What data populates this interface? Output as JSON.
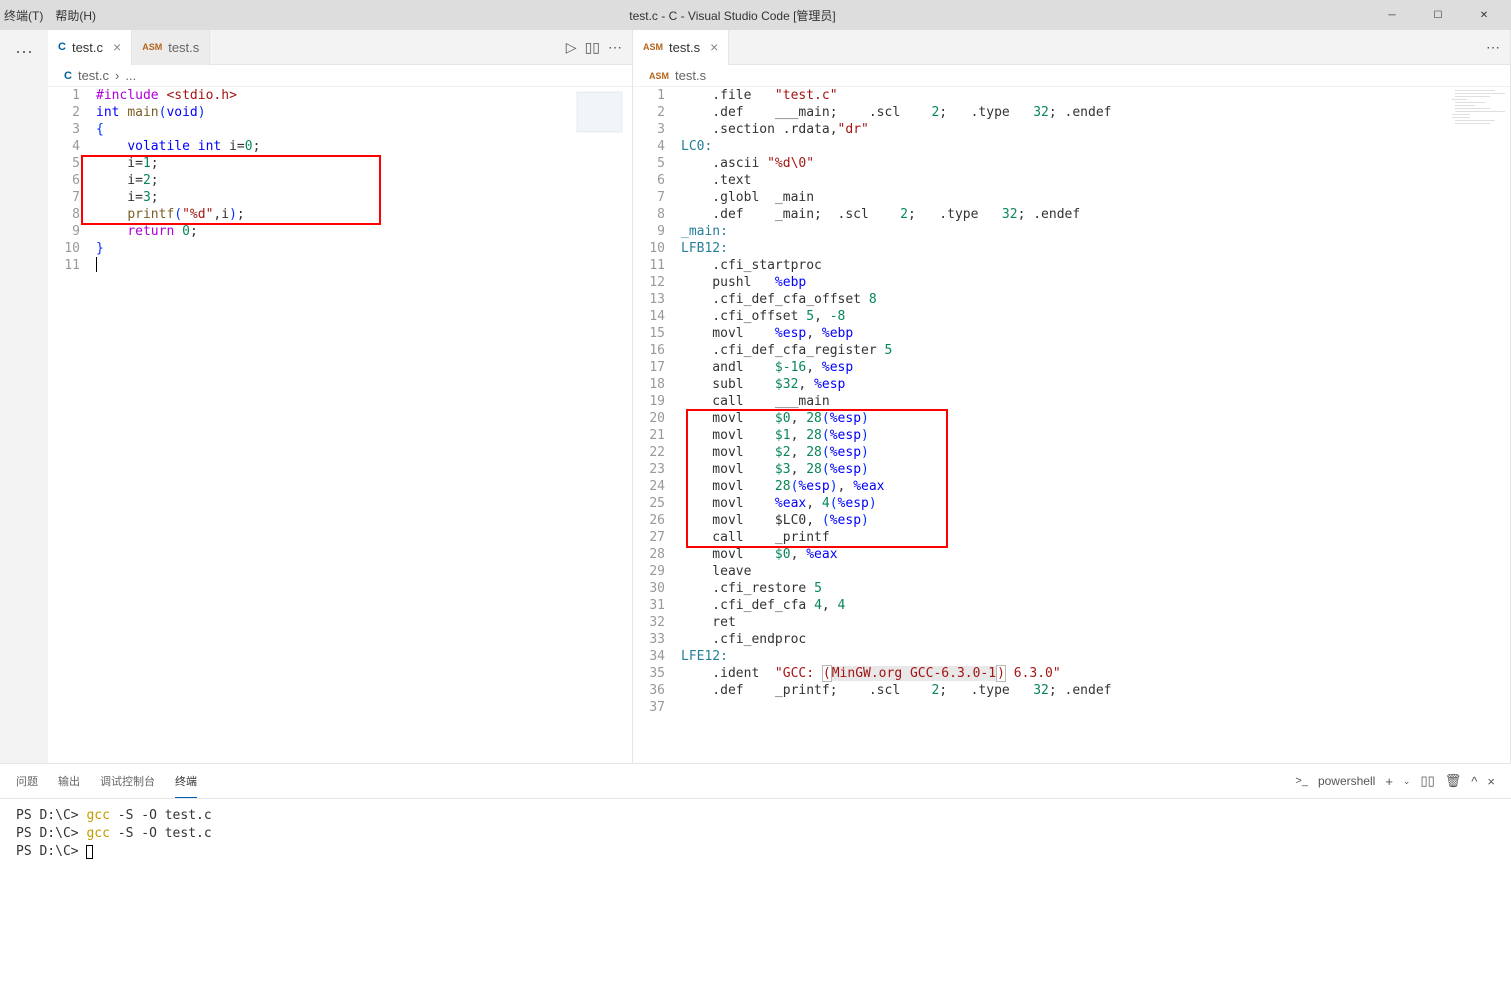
{
  "window": {
    "title": "test.c - C - Visual Studio Code [管理员]",
    "menu_terminal": "终端(T)",
    "menu_help": "帮助(H)"
  },
  "tabs": {
    "left": [
      {
        "icon": "C",
        "label": "test.c",
        "active": true,
        "close": "×"
      },
      {
        "icon": "ASM",
        "label": "test.s",
        "active": false,
        "close": ""
      }
    ],
    "right": [
      {
        "icon": "ASM",
        "label": "test.s",
        "active": true,
        "close": "×"
      }
    ]
  },
  "breadcrumb": {
    "left": {
      "icon": "C",
      "file": "test.c",
      "sep": "›",
      "more": "..."
    },
    "right": {
      "icon": "ASM",
      "file": "test.s"
    }
  },
  "editor_left": {
    "lines": [
      {
        "n": "1",
        "tokens": [
          {
            "t": "#include ",
            "c": "kw-purple"
          },
          {
            "t": "<stdio.h>",
            "c": "kw-str"
          }
        ]
      },
      {
        "n": "2",
        "tokens": [
          {
            "t": "int",
            "c": "kw-blue"
          },
          {
            "t": " ",
            "c": ""
          },
          {
            "t": "main",
            "c": "kw-brown"
          },
          {
            "t": "(",
            "c": "kw-paren"
          },
          {
            "t": "void",
            "c": "kw-blue"
          },
          {
            "t": ")",
            "c": "kw-paren"
          }
        ]
      },
      {
        "n": "3",
        "tokens": [
          {
            "t": "{",
            "c": "kw-paren"
          }
        ]
      },
      {
        "n": "4",
        "tokens": [
          {
            "t": "    ",
            "c": ""
          },
          {
            "t": "volatile",
            "c": "kw-blue"
          },
          {
            "t": " ",
            "c": ""
          },
          {
            "t": "int",
            "c": "kw-blue"
          },
          {
            "t": " i=",
            "c": ""
          },
          {
            "t": "0",
            "c": "kw-green"
          },
          {
            "t": ";",
            "c": ""
          }
        ]
      },
      {
        "n": "5",
        "tokens": [
          {
            "t": "    i=",
            "c": ""
          },
          {
            "t": "1",
            "c": "kw-green"
          },
          {
            "t": ";",
            "c": ""
          }
        ]
      },
      {
        "n": "6",
        "tokens": [
          {
            "t": "    i=",
            "c": ""
          },
          {
            "t": "2",
            "c": "kw-green"
          },
          {
            "t": ";",
            "c": ""
          }
        ]
      },
      {
        "n": "7",
        "tokens": [
          {
            "t": "    i=",
            "c": ""
          },
          {
            "t": "3",
            "c": "kw-green"
          },
          {
            "t": ";",
            "c": ""
          }
        ]
      },
      {
        "n": "8",
        "tokens": [
          {
            "t": "    ",
            "c": ""
          },
          {
            "t": "printf",
            "c": "kw-brown"
          },
          {
            "t": "(",
            "c": "kw-paren"
          },
          {
            "t": "\"%d\"",
            "c": "kw-str"
          },
          {
            "t": ",i",
            "c": ""
          },
          {
            "t": ")",
            "c": "kw-paren"
          },
          {
            "t": ";",
            "c": ""
          }
        ]
      },
      {
        "n": "9",
        "tokens": [
          {
            "t": "    ",
            "c": ""
          },
          {
            "t": "return",
            "c": "kw-purple"
          },
          {
            "t": " ",
            "c": ""
          },
          {
            "t": "0",
            "c": "kw-green"
          },
          {
            "t": ";",
            "c": ""
          }
        ]
      },
      {
        "n": "10",
        "tokens": [
          {
            "t": "}",
            "c": "kw-paren"
          }
        ]
      },
      {
        "n": "11",
        "tokens": []
      }
    ]
  },
  "editor_right": {
    "lines": [
      {
        "n": "1",
        "tokens": [
          {
            "t": "    .file   ",
            "c": ""
          },
          {
            "t": "\"test.c\"",
            "c": "kw-str"
          }
        ]
      },
      {
        "n": "2",
        "tokens": [
          {
            "t": "    .def    ___main;    .scl    ",
            "c": ""
          },
          {
            "t": "2",
            "c": "kw-green"
          },
          {
            "t": ";   .type   ",
            "c": ""
          },
          {
            "t": "32",
            "c": "kw-green"
          },
          {
            "t": "; .endef",
            "c": ""
          }
        ]
      },
      {
        "n": "3",
        "tokens": [
          {
            "t": "    .section .rdata,",
            "c": ""
          },
          {
            "t": "\"dr\"",
            "c": "kw-str"
          }
        ]
      },
      {
        "n": "4",
        "tokens": [
          {
            "t": "LC0:",
            "c": "kw-teal"
          }
        ]
      },
      {
        "n": "5",
        "tokens": [
          {
            "t": "    .ascii ",
            "c": ""
          },
          {
            "t": "\"%d\\0\"",
            "c": "kw-str"
          }
        ]
      },
      {
        "n": "6",
        "tokens": [
          {
            "t": "    .text",
            "c": ""
          }
        ]
      },
      {
        "n": "7",
        "tokens": [
          {
            "t": "    .globl  _main",
            "c": ""
          }
        ]
      },
      {
        "n": "8",
        "tokens": [
          {
            "t": "    .def    _main;  .scl    ",
            "c": ""
          },
          {
            "t": "2",
            "c": "kw-green"
          },
          {
            "t": ";   .type   ",
            "c": ""
          },
          {
            "t": "32",
            "c": "kw-green"
          },
          {
            "t": "; .endef",
            "c": ""
          }
        ]
      },
      {
        "n": "9",
        "tokens": [
          {
            "t": "_main:",
            "c": "kw-teal"
          }
        ]
      },
      {
        "n": "10",
        "tokens": [
          {
            "t": "LFB12:",
            "c": "kw-teal"
          }
        ]
      },
      {
        "n": "11",
        "tokens": [
          {
            "t": "    .cfi_startproc",
            "c": ""
          }
        ]
      },
      {
        "n": "12",
        "tokens": [
          {
            "t": "    pushl   ",
            "c": ""
          },
          {
            "t": "%ebp",
            "c": "kw-blue"
          }
        ]
      },
      {
        "n": "13",
        "tokens": [
          {
            "t": "    .cfi_def_cfa_offset ",
            "c": ""
          },
          {
            "t": "8",
            "c": "kw-green"
          }
        ]
      },
      {
        "n": "14",
        "tokens": [
          {
            "t": "    .cfi_offset ",
            "c": ""
          },
          {
            "t": "5",
            "c": "kw-green"
          },
          {
            "t": ", ",
            "c": ""
          },
          {
            "t": "-8",
            "c": "kw-green"
          }
        ]
      },
      {
        "n": "15",
        "tokens": [
          {
            "t": "    movl    ",
            "c": ""
          },
          {
            "t": "%esp",
            "c": "kw-blue"
          },
          {
            "t": ", ",
            "c": ""
          },
          {
            "t": "%ebp",
            "c": "kw-blue"
          }
        ]
      },
      {
        "n": "16",
        "tokens": [
          {
            "t": "    .cfi_def_cfa_register ",
            "c": ""
          },
          {
            "t": "5",
            "c": "kw-green"
          }
        ]
      },
      {
        "n": "17",
        "tokens": [
          {
            "t": "    andl    ",
            "c": ""
          },
          {
            "t": "$-16",
            "c": "kw-green"
          },
          {
            "t": ", ",
            "c": ""
          },
          {
            "t": "%esp",
            "c": "kw-blue"
          }
        ]
      },
      {
        "n": "18",
        "tokens": [
          {
            "t": "    subl    ",
            "c": ""
          },
          {
            "t": "$32",
            "c": "kw-green"
          },
          {
            "t": ", ",
            "c": ""
          },
          {
            "t": "%esp",
            "c": "kw-blue"
          }
        ]
      },
      {
        "n": "19",
        "tokens": [
          {
            "t": "    call    ___main",
            "c": ""
          }
        ]
      },
      {
        "n": "20",
        "tokens": [
          {
            "t": "    movl    ",
            "c": ""
          },
          {
            "t": "$0",
            "c": "kw-green"
          },
          {
            "t": ", ",
            "c": ""
          },
          {
            "t": "28",
            "c": "kw-green"
          },
          {
            "t": "(",
            "c": "kw-paren"
          },
          {
            "t": "%esp",
            "c": "kw-blue"
          },
          {
            "t": ")",
            "c": "kw-paren"
          }
        ]
      },
      {
        "n": "21",
        "tokens": [
          {
            "t": "    movl    ",
            "c": ""
          },
          {
            "t": "$1",
            "c": "kw-green"
          },
          {
            "t": ", ",
            "c": ""
          },
          {
            "t": "28",
            "c": "kw-green"
          },
          {
            "t": "(",
            "c": "kw-paren"
          },
          {
            "t": "%esp",
            "c": "kw-blue"
          },
          {
            "t": ")",
            "c": "kw-paren"
          }
        ]
      },
      {
        "n": "22",
        "tokens": [
          {
            "t": "    movl    ",
            "c": ""
          },
          {
            "t": "$2",
            "c": "kw-green"
          },
          {
            "t": ", ",
            "c": ""
          },
          {
            "t": "28",
            "c": "kw-green"
          },
          {
            "t": "(",
            "c": "kw-paren"
          },
          {
            "t": "%esp",
            "c": "kw-blue"
          },
          {
            "t": ")",
            "c": "kw-paren"
          }
        ]
      },
      {
        "n": "23",
        "tokens": [
          {
            "t": "    movl    ",
            "c": ""
          },
          {
            "t": "$3",
            "c": "kw-green"
          },
          {
            "t": ", ",
            "c": ""
          },
          {
            "t": "28",
            "c": "kw-green"
          },
          {
            "t": "(",
            "c": "kw-paren"
          },
          {
            "t": "%esp",
            "c": "kw-blue"
          },
          {
            "t": ")",
            "c": "kw-paren"
          }
        ]
      },
      {
        "n": "24",
        "tokens": [
          {
            "t": "    movl    ",
            "c": ""
          },
          {
            "t": "28",
            "c": "kw-green"
          },
          {
            "t": "(",
            "c": "kw-paren"
          },
          {
            "t": "%esp",
            "c": "kw-blue"
          },
          {
            "t": ")",
            "c": "kw-paren"
          },
          {
            "t": ", ",
            "c": ""
          },
          {
            "t": "%eax",
            "c": "kw-blue"
          }
        ]
      },
      {
        "n": "25",
        "tokens": [
          {
            "t": "    movl    ",
            "c": ""
          },
          {
            "t": "%eax",
            "c": "kw-blue"
          },
          {
            "t": ", ",
            "c": ""
          },
          {
            "t": "4",
            "c": "kw-green"
          },
          {
            "t": "(",
            "c": "kw-paren"
          },
          {
            "t": "%esp",
            "c": "kw-blue"
          },
          {
            "t": ")",
            "c": "kw-paren"
          }
        ]
      },
      {
        "n": "26",
        "tokens": [
          {
            "t": "    movl    $LC0, ",
            "c": ""
          },
          {
            "t": "(",
            "c": "kw-paren"
          },
          {
            "t": "%esp",
            "c": "kw-blue"
          },
          {
            "t": ")",
            "c": "kw-paren"
          }
        ]
      },
      {
        "n": "27",
        "tokens": [
          {
            "t": "    call    _printf",
            "c": ""
          }
        ]
      },
      {
        "n": "28",
        "tokens": [
          {
            "t": "    movl    ",
            "c": ""
          },
          {
            "t": "$0",
            "c": "kw-green"
          },
          {
            "t": ", ",
            "c": ""
          },
          {
            "t": "%eax",
            "c": "kw-blue"
          }
        ]
      },
      {
        "n": "29",
        "tokens": [
          {
            "t": "    leave",
            "c": ""
          }
        ]
      },
      {
        "n": "30",
        "tokens": [
          {
            "t": "    .cfi_restore ",
            "c": ""
          },
          {
            "t": "5",
            "c": "kw-green"
          }
        ]
      },
      {
        "n": "31",
        "tokens": [
          {
            "t": "    .cfi_def_cfa ",
            "c": ""
          },
          {
            "t": "4",
            "c": "kw-green"
          },
          {
            "t": ", ",
            "c": ""
          },
          {
            "t": "4",
            "c": "kw-green"
          }
        ]
      },
      {
        "n": "32",
        "tokens": [
          {
            "t": "    ret",
            "c": ""
          }
        ]
      },
      {
        "n": "33",
        "tokens": [
          {
            "t": "    .cfi_endproc",
            "c": ""
          }
        ]
      },
      {
        "n": "34",
        "tokens": [
          {
            "t": "LFE12:",
            "c": "kw-teal"
          }
        ]
      },
      {
        "n": "35",
        "tokens": [
          {
            "t": "    .ident  ",
            "c": ""
          },
          {
            "t": "\"GCC: ",
            "c": "kw-str"
          },
          {
            "t": "(",
            "c": "kw-str bracket-hl"
          },
          {
            "t": "MinGW.org GCC-6.3.0-1",
            "c": "kw-str kw-hl"
          },
          {
            "t": ")",
            "c": "kw-str bracket-hl"
          },
          {
            "t": " 6.3.0\"",
            "c": "kw-str"
          }
        ]
      },
      {
        "n": "36",
        "tokens": [
          {
            "t": "    .def    _printf;    .scl    ",
            "c": ""
          },
          {
            "t": "2",
            "c": "kw-green"
          },
          {
            "t": ";   .type   ",
            "c": ""
          },
          {
            "t": "32",
            "c": "kw-green"
          },
          {
            "t": "; .endef",
            "c": ""
          }
        ]
      },
      {
        "n": "37",
        "tokens": []
      }
    ]
  },
  "panel": {
    "tabs": {
      "problems": "问题",
      "output": "输出",
      "debug": "调试控制台",
      "terminal": "终端"
    },
    "right": {
      "shell_icon": "⌨",
      "shell": "powershell",
      "plus": "+",
      "split": "▯",
      "trash": "🗑",
      "up": "^",
      "close": "×"
    }
  },
  "terminal": [
    {
      "prompt": "PS D:\\C> ",
      "cmd": "gcc",
      "args": " -S -O test.c"
    },
    {
      "prompt": "PS D:\\C> ",
      "cmd": "gcc",
      "args": " -S -O test.c"
    },
    {
      "prompt": "PS D:\\C> ",
      "cmd": "",
      "args": ""
    }
  ]
}
